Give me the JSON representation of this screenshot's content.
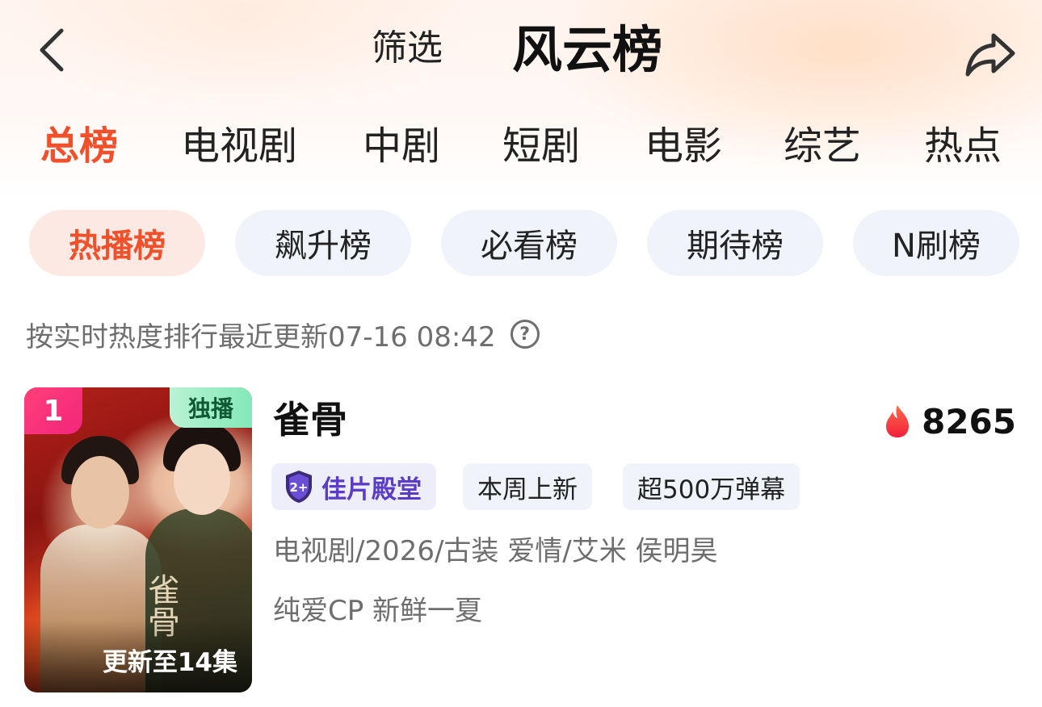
{
  "header": {
    "back_icon": "chevron-left-icon",
    "filter_label": "筛选",
    "title": "风云榜",
    "share_icon": "share-arrow-icon"
  },
  "category_tabs": [
    {
      "label": "总榜",
      "active": true
    },
    {
      "label": "电视剧",
      "active": false
    },
    {
      "label": "中剧",
      "active": false
    },
    {
      "label": "短剧",
      "active": false
    },
    {
      "label": "电影",
      "active": false
    },
    {
      "label": "综艺",
      "active": false
    },
    {
      "label": "热点",
      "active": false
    }
  ],
  "ranking_chips": [
    {
      "label": "热播榜",
      "active": true
    },
    {
      "label": "飙升榜",
      "active": false
    },
    {
      "label": "必看榜",
      "active": false
    },
    {
      "label": "期待榜",
      "active": false
    },
    {
      "label": "N刷榜",
      "active": false
    }
  ],
  "update_info": {
    "text": "按实时热度排行最近更新07-16 08:42",
    "help_icon": "question-circle-icon",
    "help_glyph": "?"
  },
  "items": [
    {
      "rank": "1",
      "exclusive_label": "独播",
      "episode_label": "更新至14集",
      "poster_title_art": "雀骨",
      "title": "雀骨",
      "heat_icon": "flame-icon",
      "heat_value": "8265",
      "tags": [
        {
          "label": "佳片殿堂",
          "icon": "award-shield-icon",
          "badge_text": "2+"
        },
        {
          "label": "本周上新"
        },
        {
          "label": "超500万弹幕"
        }
      ],
      "meta_line": "电视剧/2026/古装 爱情/艾米 侯明昊",
      "tagline": "纯爱CP 新鲜一夏"
    }
  ],
  "colors": {
    "accent": "#f1502b",
    "chip_background": "#f0f3f9",
    "chip_active_background": "#fde9e4",
    "rank_badge": "#f2267a",
    "exclusive_badge": "#83e8b7",
    "award_text": "#5a3cc8",
    "secondary_text": "#6e6e6e"
  }
}
